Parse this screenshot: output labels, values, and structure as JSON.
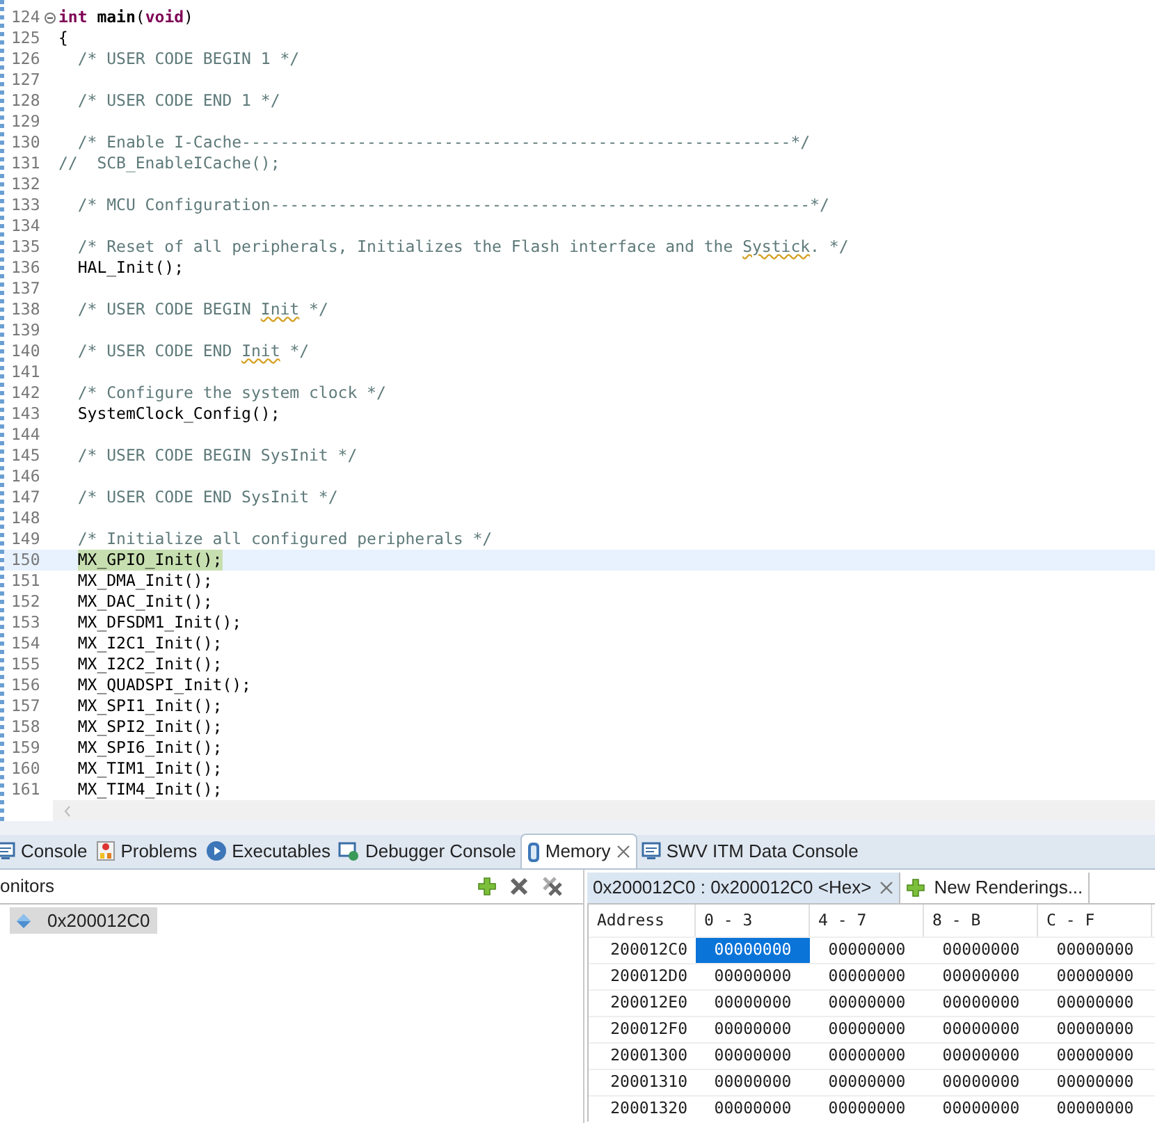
{
  "editor": {
    "lines": [
      {
        "number": "124",
        "fold": true,
        "current": false,
        "tokens": [
          {
            "text": "int",
            "kind": "keyword"
          },
          {
            "text": " main",
            "kind": "bold"
          },
          {
            "text": "(",
            "kind": "code"
          },
          {
            "text": "void",
            "kind": "keyword"
          },
          {
            "text": ")",
            "kind": "code"
          }
        ]
      },
      {
        "number": "125",
        "fold": false,
        "current": false,
        "tokens": [
          {
            "text": "{",
            "kind": "code"
          }
        ]
      },
      {
        "number": "126",
        "fold": false,
        "current": false,
        "tokens": [
          {
            "text": "  /* USER CODE BEGIN 1 */",
            "kind": "comment"
          }
        ]
      },
      {
        "number": "127",
        "fold": false,
        "current": false
      },
      {
        "number": "128",
        "fold": false,
        "current": false,
        "tokens": [
          {
            "text": "  /* USER CODE END 1 */",
            "kind": "comment"
          }
        ]
      },
      {
        "number": "129",
        "fold": false,
        "current": false
      },
      {
        "number": "130",
        "fold": false,
        "current": false,
        "tokens": [
          {
            "text": "  /* Enable I-Cache---------------------------------------------------------*/",
            "kind": "comment"
          }
        ]
      },
      {
        "number": "131",
        "fold": false,
        "current": false,
        "tokens": [
          {
            "text": "//  SCB_EnableICache();",
            "kind": "comment"
          }
        ]
      },
      {
        "number": "132",
        "fold": false,
        "current": false
      },
      {
        "number": "133",
        "fold": false,
        "current": false,
        "tokens": [
          {
            "text": "  /* MCU Configuration--------------------------------------------------------*/",
            "kind": "comment"
          }
        ]
      },
      {
        "number": "134",
        "fold": false,
        "current": false
      },
      {
        "number": "135",
        "fold": false,
        "current": false,
        "tokens": [
          {
            "text": "  /* Reset of all peripherals, Initializes the Flash interface and the ",
            "kind": "comment"
          },
          {
            "text": "Systick",
            "kind": "misspelled"
          },
          {
            "text": ". */",
            "kind": "comment"
          }
        ]
      },
      {
        "number": "136",
        "fold": false,
        "current": false,
        "tokens": [
          {
            "text": "  HAL_Init();",
            "kind": "code"
          }
        ]
      },
      {
        "number": "137",
        "fold": false,
        "current": false
      },
      {
        "number": "138",
        "fold": false,
        "current": false,
        "tokens": [
          {
            "text": "  /* USER CODE BEGIN ",
            "kind": "comment"
          },
          {
            "text": "Init",
            "kind": "misspelled"
          },
          {
            "text": " */",
            "kind": "comment"
          }
        ]
      },
      {
        "number": "139",
        "fold": false,
        "current": false
      },
      {
        "number": "140",
        "fold": false,
        "current": false,
        "tokens": [
          {
            "text": "  /* USER CODE END ",
            "kind": "comment"
          },
          {
            "text": "Init",
            "kind": "misspelled"
          },
          {
            "text": " */",
            "kind": "comment"
          }
        ]
      },
      {
        "number": "141",
        "fold": false,
        "current": false
      },
      {
        "number": "142",
        "fold": false,
        "current": false,
        "tokens": [
          {
            "text": "  /* Configure the system clock */",
            "kind": "comment"
          }
        ]
      },
      {
        "number": "143",
        "fold": false,
        "current": false,
        "tokens": [
          {
            "text": "  SystemClock_Config();",
            "kind": "code"
          }
        ]
      },
      {
        "number": "144",
        "fold": false,
        "current": false
      },
      {
        "number": "145",
        "fold": false,
        "current": false,
        "tokens": [
          {
            "text": "  /* USER CODE BEGIN SysInit */",
            "kind": "comment"
          }
        ]
      },
      {
        "number": "146",
        "fold": false,
        "current": false
      },
      {
        "number": "147",
        "fold": false,
        "current": false,
        "tokens": [
          {
            "text": "  /* USER CODE END SysInit */",
            "kind": "comment"
          }
        ]
      },
      {
        "number": "148",
        "fold": false,
        "current": false
      },
      {
        "number": "149",
        "fold": false,
        "current": false,
        "tokens": [
          {
            "text": "  /* Initialize all configured peripherals */",
            "kind": "comment"
          }
        ]
      },
      {
        "number": "150",
        "fold": false,
        "current": true,
        "tokens": [
          {
            "text": "  MX_GPIO_Init();",
            "kind": "code"
          }
        ]
      },
      {
        "number": "151",
        "fold": false,
        "current": false,
        "tokens": [
          {
            "text": "  MX_DMA_Init();",
            "kind": "code"
          }
        ]
      },
      {
        "number": "152",
        "fold": false,
        "current": false,
        "tokens": [
          {
            "text": "  MX_DAC_Init();",
            "kind": "code"
          }
        ]
      },
      {
        "number": "153",
        "fold": false,
        "current": false,
        "tokens": [
          {
            "text": "  MX_DFSDM1_Init();",
            "kind": "code"
          }
        ]
      },
      {
        "number": "154",
        "fold": false,
        "current": false,
        "tokens": [
          {
            "text": "  MX_I2C1_Init();",
            "kind": "code"
          }
        ]
      },
      {
        "number": "155",
        "fold": false,
        "current": false,
        "tokens": [
          {
            "text": "  MX_I2C2_Init();",
            "kind": "code"
          }
        ]
      },
      {
        "number": "156",
        "fold": false,
        "current": false,
        "tokens": [
          {
            "text": "  MX_QUADSPI_Init();",
            "kind": "code"
          }
        ]
      },
      {
        "number": "157",
        "fold": false,
        "current": false,
        "tokens": [
          {
            "text": "  MX_SPI1_Init();",
            "kind": "code"
          }
        ]
      },
      {
        "number": "158",
        "fold": false,
        "current": false,
        "tokens": [
          {
            "text": "  MX_SPI2_Init();",
            "kind": "code"
          }
        ]
      },
      {
        "number": "159",
        "fold": false,
        "current": false,
        "tokens": [
          {
            "text": "  MX_SPI6_Init();",
            "kind": "code"
          }
        ]
      },
      {
        "number": "160",
        "fold": false,
        "current": false,
        "tokens": [
          {
            "text": "  MX_TIM1_Init();",
            "kind": "code"
          }
        ]
      },
      {
        "number": "161",
        "fold": false,
        "current": false,
        "tokens": [
          {
            "text": "  MX_TIM4_Init();",
            "kind": "code"
          }
        ]
      }
    ]
  },
  "panel_tabs": [
    {
      "label": "Console",
      "kind": "console",
      "selected": false,
      "closable": false
    },
    {
      "label": "Problems",
      "kind": "problems",
      "selected": false,
      "closable": false
    },
    {
      "label": "Executables",
      "kind": "executables",
      "selected": false,
      "closable": false
    },
    {
      "label": "Debugger Console",
      "kind": "debugger",
      "selected": false,
      "closable": false
    },
    {
      "label": "Memory",
      "kind": "memory",
      "selected": true,
      "closable": true
    },
    {
      "label": "SWV ITM Data Console",
      "kind": "console",
      "selected": false,
      "closable": false
    }
  ],
  "monitors": {
    "header": "onitors",
    "items": [
      {
        "label": "0x200012C0",
        "selected": true
      }
    ]
  },
  "renderings": {
    "tabs": [
      {
        "label": "0x200012C0 : 0x200012C0 <Hex>",
        "kind": "rendering",
        "selected": true
      },
      {
        "label": "New Renderings...",
        "kind": "new",
        "selected": false
      }
    ],
    "columns": [
      "Address",
      "0 - 3",
      "4 - 7",
      "8 - B",
      "C - F"
    ],
    "rows": [
      {
        "cells": [
          {
            "value": "200012C0",
            "selected": false
          },
          {
            "value": "00000000",
            "selected": true
          },
          {
            "value": "00000000",
            "selected": false
          },
          {
            "value": "00000000",
            "selected": false
          },
          {
            "value": "00000000",
            "selected": false
          }
        ]
      },
      {
        "cells": [
          {
            "value": "200012D0",
            "selected": false
          },
          {
            "value": "00000000",
            "selected": false
          },
          {
            "value": "00000000",
            "selected": false
          },
          {
            "value": "00000000",
            "selected": false
          },
          {
            "value": "00000000",
            "selected": false
          }
        ]
      },
      {
        "cells": [
          {
            "value": "200012E0",
            "selected": false
          },
          {
            "value": "00000000",
            "selected": false
          },
          {
            "value": "00000000",
            "selected": false
          },
          {
            "value": "00000000",
            "selected": false
          },
          {
            "value": "00000000",
            "selected": false
          }
        ]
      },
      {
        "cells": [
          {
            "value": "200012F0",
            "selected": false
          },
          {
            "value": "00000000",
            "selected": false
          },
          {
            "value": "00000000",
            "selected": false
          },
          {
            "value": "00000000",
            "selected": false
          },
          {
            "value": "00000000",
            "selected": false
          }
        ]
      },
      {
        "cells": [
          {
            "value": "20001300",
            "selected": false
          },
          {
            "value": "00000000",
            "selected": false
          },
          {
            "value": "00000000",
            "selected": false
          },
          {
            "value": "00000000",
            "selected": false
          },
          {
            "value": "00000000",
            "selected": false
          }
        ]
      },
      {
        "cells": [
          {
            "value": "20001310",
            "selected": false
          },
          {
            "value": "00000000",
            "selected": false
          },
          {
            "value": "00000000",
            "selected": false
          },
          {
            "value": "00000000",
            "selected": false
          },
          {
            "value": "00000000",
            "selected": false
          }
        ]
      },
      {
        "cells": [
          {
            "value": "20001320",
            "selected": false
          },
          {
            "value": "00000000",
            "selected": false
          },
          {
            "value": "00000000",
            "selected": false
          },
          {
            "value": "00000000",
            "selected": false
          },
          {
            "value": "00000000",
            "selected": false
          }
        ]
      }
    ]
  }
}
